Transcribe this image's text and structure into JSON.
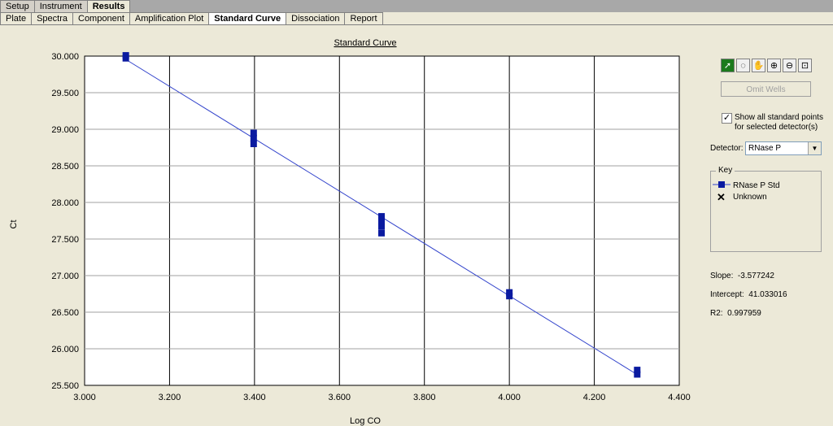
{
  "tabs_row1": [
    {
      "label": "Setup",
      "active": false
    },
    {
      "label": "Instrument",
      "active": false
    },
    {
      "label": "Results",
      "active": true
    }
  ],
  "tabs_row2": [
    {
      "label": "Plate",
      "active": false
    },
    {
      "label": "Spectra",
      "active": false
    },
    {
      "label": "Component",
      "active": false
    },
    {
      "label": "Amplification Plot",
      "active": false
    },
    {
      "label": "Standard Curve",
      "active": true
    },
    {
      "label": "Dissociation",
      "active": false
    },
    {
      "label": "Report",
      "active": false
    }
  ],
  "toolbar": {
    "tools": [
      "select-arrow-icon",
      "lasso-icon",
      "hand-pan-icon",
      "zoom-in-icon",
      "zoom-out-icon",
      "zoom-fit-icon"
    ],
    "omit_label": "Omit Wells"
  },
  "options": {
    "show_all_checked": true,
    "show_all_line1": "Show all standard points",
    "show_all_line2": "for selected detector(s)",
    "detector_label": "Detector:",
    "detector_value": "RNase P"
  },
  "key": {
    "title": "Key",
    "std_label": "RNase P Std",
    "unknown_label": "Unknown"
  },
  "stats": {
    "slope_label": "Slope:",
    "slope_value": "-3.577242",
    "intercept_label": "Intercept:",
    "intercept_value": "41.033016",
    "r2_label": "R2:",
    "r2_value": "0.997959"
  },
  "colors": {
    "series": "#0a1aa0",
    "line": "#3344cc"
  },
  "chart_data": {
    "type": "scatter",
    "title": "Standard Curve",
    "xlabel": "Log CO",
    "ylabel": "Ct",
    "xlim": [
      3.0,
      4.4
    ],
    "ylim": [
      25.5,
      30.0
    ],
    "xticks": [
      "3.000",
      "3.200",
      "3.400",
      "3.600",
      "3.800",
      "4.000",
      "4.200",
      "4.400"
    ],
    "yticks": [
      "25.500",
      "26.000",
      "26.500",
      "27.000",
      "27.500",
      "28.000",
      "28.500",
      "29.000",
      "29.500",
      "30.000"
    ],
    "grid": true,
    "series": [
      {
        "name": "RNase P Std",
        "points": [
          {
            "x": 3.097,
            "y": 30.01
          },
          {
            "x": 3.097,
            "y": 29.97
          },
          {
            "x": 3.398,
            "y": 28.95
          },
          {
            "x": 3.398,
            "y": 28.88
          },
          {
            "x": 3.398,
            "y": 28.8
          },
          {
            "x": 3.699,
            "y": 27.81
          },
          {
            "x": 3.699,
            "y": 27.74
          },
          {
            "x": 3.699,
            "y": 27.67
          },
          {
            "x": 3.699,
            "y": 27.58
          },
          {
            "x": 4.0,
            "y": 26.77
          },
          {
            "x": 4.0,
            "y": 26.72
          },
          {
            "x": 4.301,
            "y": 25.71
          },
          {
            "x": 4.301,
            "y": 25.65
          }
        ]
      }
    ],
    "fit_line": {
      "slope": -3.577242,
      "intercept": 41.033016,
      "x_range": [
        3.097,
        4.301
      ]
    }
  }
}
